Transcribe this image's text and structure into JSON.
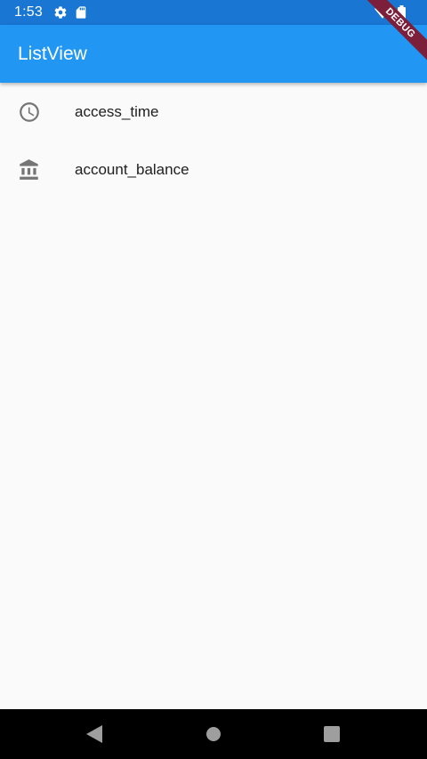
{
  "status_bar": {
    "time": "1:53",
    "icons": [
      "gear-icon",
      "sd-card-icon",
      "wifi-icon",
      "battery-icon"
    ]
  },
  "app_bar": {
    "title": "ListView"
  },
  "debug_banner": {
    "label": "DEBUG"
  },
  "list": {
    "items": [
      {
        "icon": "access-time-icon",
        "label": "access_time"
      },
      {
        "icon": "account-balance-icon",
        "label": "account_balance"
      }
    ]
  },
  "nav_bar": {
    "buttons": [
      "back-icon",
      "home-icon",
      "recents-icon"
    ]
  },
  "colors": {
    "status_bar": "#1976d2",
    "app_bar": "#2196f3",
    "background": "#fafafa",
    "icon": "#757575",
    "debug_ribbon": "#7b1f3a"
  }
}
